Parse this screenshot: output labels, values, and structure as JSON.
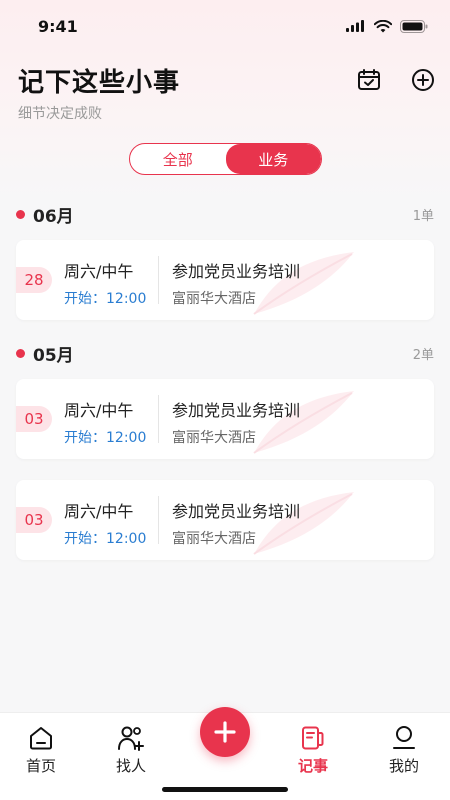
{
  "status": {
    "time": "9:41"
  },
  "header": {
    "title": "记下这些小事",
    "subtitle": "细节决定成败"
  },
  "segment": {
    "all_label": "全部",
    "business_label": "业务",
    "selected": "业务"
  },
  "groups": [
    {
      "month": "06月",
      "count": "1单",
      "events": [
        {
          "day": "28",
          "weekday": "周六/中午",
          "start": "开始：12:00",
          "title": "参加党员业务培训",
          "venue": "富丽华大酒店"
        }
      ]
    },
    {
      "month": "05月",
      "count": "2单",
      "events": [
        {
          "day": "03",
          "weekday": "周六/中午",
          "start": "开始：12:00",
          "title": "参加党员业务培训",
          "venue": "富丽华大酒店"
        },
        {
          "day": "03",
          "weekday": "周六/中午",
          "start": "开始：12:00",
          "title": "参加党员业务培训",
          "venue": "富丽华大酒店"
        }
      ]
    }
  ],
  "tabbar": {
    "home": "首页",
    "find": "找人",
    "notes": "记事",
    "mine": "我的",
    "active": "记事"
  },
  "icons": {
    "calendar": "calendar-check-icon",
    "add": "plus-circle-icon",
    "fab": "plus-icon"
  },
  "colors": {
    "accent": "#e8344d",
    "link": "#2a7dd1",
    "badge_bg": "#fde3e7"
  }
}
